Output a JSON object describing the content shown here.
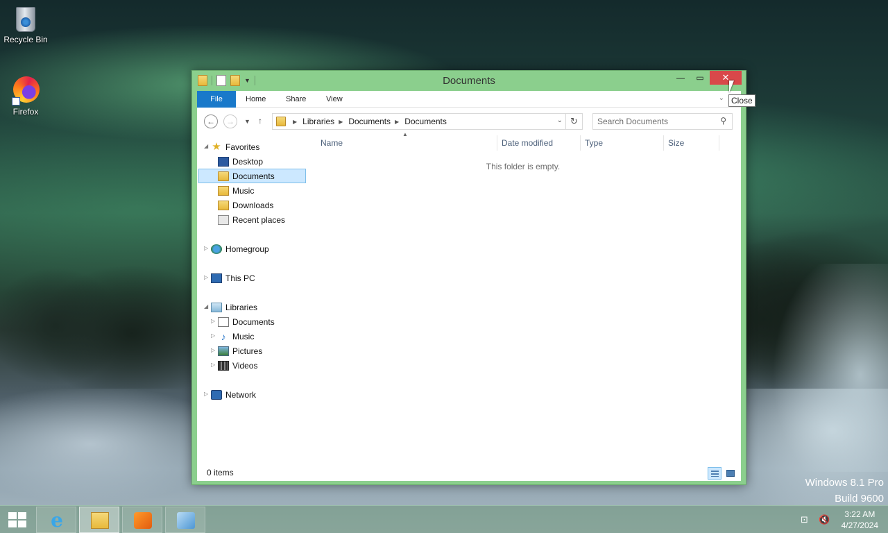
{
  "desktop": {
    "icons": [
      {
        "label": "Recycle Bin",
        "icon": "recycle-bin-icon"
      },
      {
        "label": "Firefox",
        "icon": "firefox-icon"
      }
    ],
    "watermark": {
      "line1": "Windows 8.1 Pro",
      "line2": "Build 9600"
    }
  },
  "window": {
    "title": "Documents",
    "tooltip": "Close",
    "ribbon_tabs": [
      "File",
      "Home",
      "Share",
      "View"
    ],
    "breadcrumb": [
      "Libraries",
      "Documents",
      "Documents"
    ],
    "search_placeholder": "Search Documents",
    "nav": {
      "favorites": {
        "label": "Favorites",
        "items": [
          "Desktop",
          "Documents",
          "Music",
          "Downloads",
          "Recent places"
        ],
        "selected": "Documents"
      },
      "homegroup": "Homegroup",
      "this_pc": "This PC",
      "libraries": {
        "label": "Libraries",
        "items": [
          "Documents",
          "Music",
          "Pictures",
          "Videos"
        ]
      },
      "network": "Network"
    },
    "columns": [
      "Name",
      "Date modified",
      "Type",
      "Size"
    ],
    "empty_message": "This folder is empty.",
    "status": "0 items"
  },
  "taskbar": {
    "apps": [
      {
        "name": "Internet Explorer",
        "icon": "internet-explorer-icon"
      },
      {
        "name": "File Explorer",
        "icon": "file-explorer-icon",
        "active": true
      },
      {
        "name": "Windows Media Player",
        "icon": "media-player-icon"
      },
      {
        "name": "Network",
        "icon": "network-app-icon"
      }
    ],
    "clock": {
      "time": "3:22 AM",
      "date": "4/27/2024"
    }
  },
  "colors": {
    "window_frame": "#8bcf8d",
    "close_button": "#d9484a",
    "file_tab": "#1979ca",
    "selection": "#cce8ff"
  }
}
